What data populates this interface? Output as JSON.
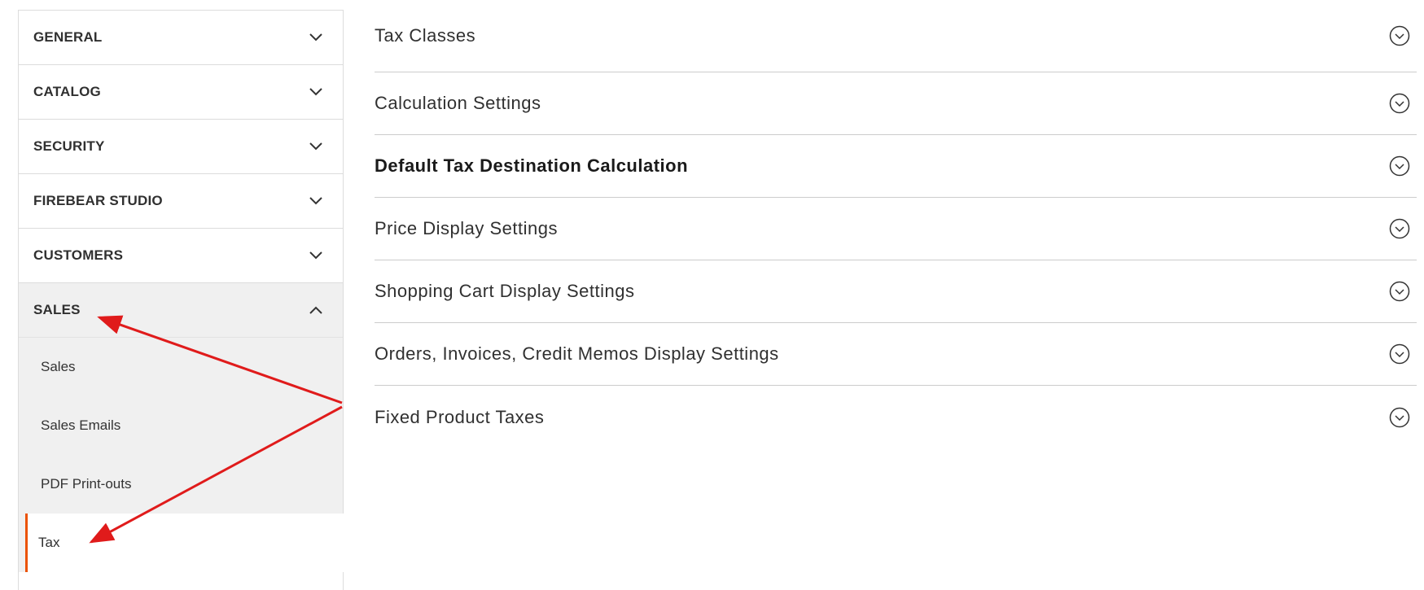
{
  "sidebar": {
    "groups": [
      {
        "label": "GENERAL",
        "expanded": false,
        "icon": "chevron-down-icon"
      },
      {
        "label": "CATALOG",
        "expanded": false,
        "icon": "chevron-down-icon"
      },
      {
        "label": "SECURITY",
        "expanded": false,
        "icon": "chevron-down-icon"
      },
      {
        "label": "FIREBEAR STUDIO",
        "expanded": false,
        "icon": "chevron-down-icon"
      },
      {
        "label": "CUSTOMERS",
        "expanded": false,
        "icon": "chevron-down-icon"
      },
      {
        "label": "SALES",
        "expanded": true,
        "icon": "chevron-up-icon"
      }
    ],
    "sales_items": [
      {
        "label": "Sales"
      },
      {
        "label": "Sales Emails"
      },
      {
        "label": "PDF Print-outs"
      },
      {
        "label": "Tax",
        "current": true
      }
    ]
  },
  "main": {
    "sections": [
      {
        "title": "Tax Classes",
        "icon": "expand-circle-icon"
      },
      {
        "title": "Calculation Settings",
        "icon": "expand-circle-icon"
      },
      {
        "title": "Default Tax Destination Calculation",
        "icon": "expand-circle-icon"
      },
      {
        "title": "Price Display Settings",
        "icon": "expand-circle-icon"
      },
      {
        "title": "Shopping Cart Display Settings",
        "icon": "expand-circle-icon"
      },
      {
        "title": "Orders, Invoices, Credit Memos Display Settings",
        "icon": "expand-circle-icon"
      },
      {
        "title": "Fixed Product Taxes",
        "icon": "expand-circle-icon"
      }
    ]
  },
  "colors": {
    "accent": "#eb5202",
    "annotation_arrow": "#e01b1b",
    "active_bg": "#f0f0f0"
  }
}
